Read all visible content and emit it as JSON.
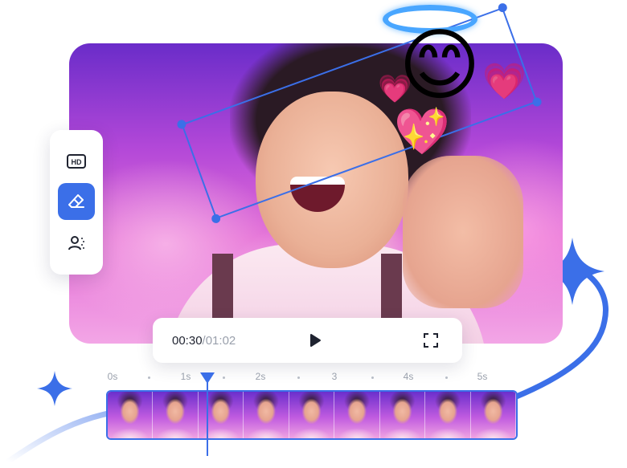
{
  "player": {
    "current_time": "00:30",
    "separator": "/",
    "total_time": "01:02"
  },
  "tools": [
    {
      "name": "hd-enhance",
      "label": "HD",
      "active": false
    },
    {
      "name": "eraser",
      "active": true
    },
    {
      "name": "background-remover",
      "active": false
    }
  ],
  "timeline": {
    "ticks": [
      "0s",
      "1s",
      "2s",
      "3",
      "4s",
      "5s"
    ],
    "frame_count": 9,
    "playhead_position": "1.3s"
  },
  "sticker": {
    "emoji": "😊",
    "hearts": [
      "💗",
      "💗",
      "💖"
    ]
  },
  "colors": {
    "accent": "#3b6fe8",
    "halo": "#49a6ff",
    "background": "#ffffff"
  }
}
